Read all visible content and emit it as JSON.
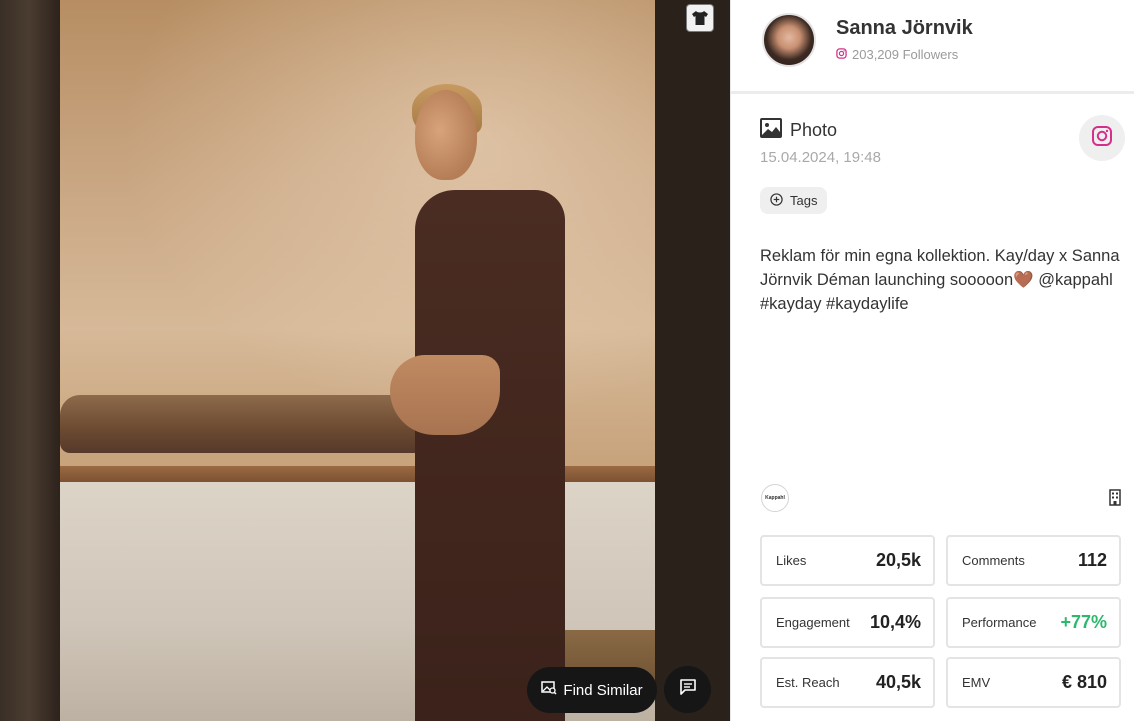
{
  "profile": {
    "name": "Sanna Jörnvik",
    "followers": "203,209 Followers"
  },
  "post": {
    "type_label": "Photo",
    "date": "15.04.2024, 19:48",
    "tags_label": "Tags",
    "caption": "Reklam för min egna kollektion. Kay/day x Sanna Jörnvik Déman launching sooooon🤎 @kappahl #kayday #kaydaylife",
    "brand_logo_text": "Kappahl"
  },
  "media": {
    "find_similar_label": "Find Similar"
  },
  "stats": [
    {
      "label": "Likes",
      "value": "20,5k"
    },
    {
      "label": "Comments",
      "value": "112"
    },
    {
      "label": "Engagement",
      "value": "10,4%"
    },
    {
      "label": "Performance",
      "value": "+77%"
    },
    {
      "label": "Est. Reach",
      "value": "40,5k"
    },
    {
      "label": "EMV",
      "value": "€ 810"
    }
  ],
  "colors": {
    "instagram": "#d62f8a",
    "positive": "#2db86e",
    "dark_button": "#161616"
  },
  "icons": {
    "shirt_badge": "tshirt-icon",
    "platform": "instagram-icon",
    "post_type": "image-icon",
    "tags": "plus-circle-icon",
    "find_similar": "image-search-icon",
    "comment": "comment-icon",
    "brand_type": "building-icon"
  }
}
